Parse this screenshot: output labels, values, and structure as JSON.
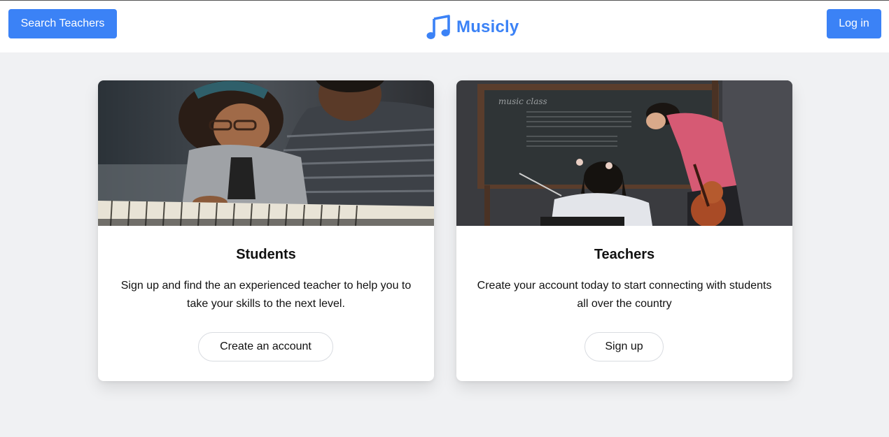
{
  "header": {
    "search_label": "Search Teachers",
    "brand_name": "Musicly",
    "brand_icon": "music-note-icon",
    "login_label": "Log in"
  },
  "colors": {
    "accent": "#3b82f6",
    "page_bg": "#f0f1f3",
    "card_bg": "#ffffff"
  },
  "cards": [
    {
      "image": "girl-and-man-playing-piano-photo",
      "title": "Students",
      "text": "Sign up and find the an experienced teacher to help you to take your skills to the next level.",
      "button_label": "Create an account"
    },
    {
      "image": "teacher-with-violin-student-at-chalkboard-photo",
      "title": "Teachers",
      "text": "Create your account today to start connecting with students all over the country",
      "button_label": "Sign up"
    }
  ]
}
